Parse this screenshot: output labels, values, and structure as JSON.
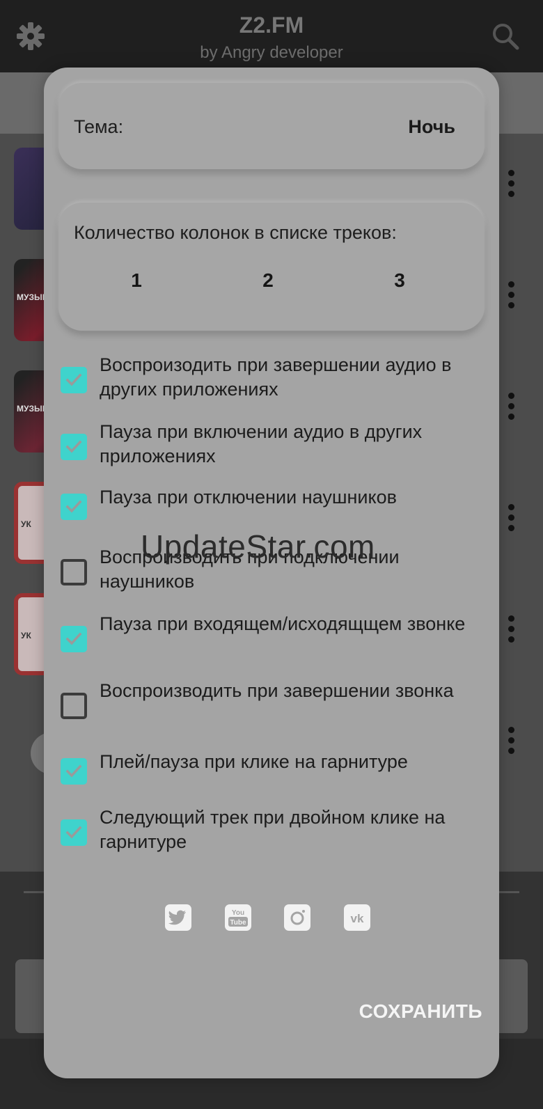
{
  "app": {
    "title": "Z2.FM",
    "subtitle": "by Angry developer"
  },
  "background": {
    "thumb_texts": [
      "МУЗЫК",
      "МУЗЫК",
      "УК",
      "УК"
    ]
  },
  "dialog": {
    "theme": {
      "label": "Тема:",
      "value": "Ночь"
    },
    "columns": {
      "label": "Количество колонок в списке треков:",
      "options": [
        "1",
        "2",
        "3"
      ]
    },
    "options": [
      {
        "label": "Воспроизодить при завершении аудио в других приложениях",
        "checked": true
      },
      {
        "label": "Пауза при включении аудио в других приложениях",
        "checked": true
      },
      {
        "label": "Пауза при отключении наушников",
        "checked": true
      },
      {
        "label": "Воспроизводить при подключении наушников",
        "checked": false
      },
      {
        "label": "Пауза при входящем/исходящщем звонке",
        "checked": true
      },
      {
        "label": "Воспроизводить при завершении звонка",
        "checked": false
      },
      {
        "label": "Плей/пауза при клике на гарнитуре",
        "checked": true
      },
      {
        "label": "Следующий трек при двойном клике на гарнитуре",
        "checked": true
      }
    ],
    "social": [
      "twitter-icon",
      "youtube-icon",
      "instagram-icon",
      "vk-icon"
    ],
    "social_text": {
      "youtube_top": "You",
      "youtube_bottom": "Tube",
      "vk": "vk"
    },
    "save_label": "СОХРАНИТЬ"
  },
  "watermark": "UpdateStar.com",
  "colors": {
    "checkbox_on": "#3fd3cc",
    "dialog_bg": "#a4a4a4",
    "save_text": "#f5f5f5"
  }
}
